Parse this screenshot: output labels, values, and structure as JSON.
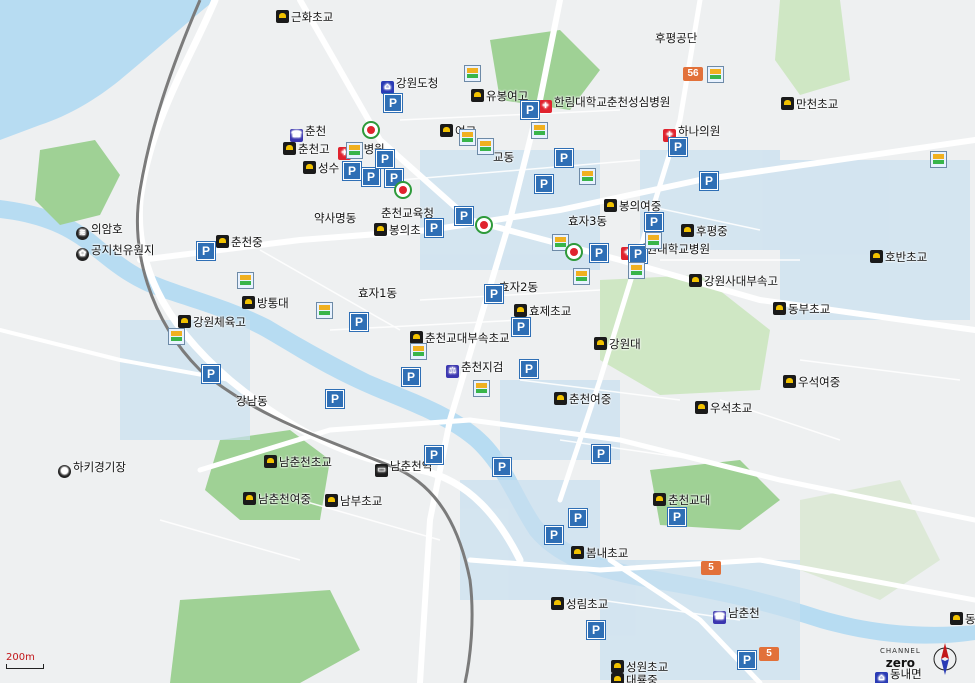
{
  "map": {
    "scale_label": "200m",
    "brand": {
      "line1": "CHANNEL",
      "line2": "zero"
    },
    "compass": {
      "name": "compass-rose",
      "north": "N"
    },
    "colors": {
      "background": "#eef0f1",
      "water": "#b7dcf2",
      "green": "#9fd195",
      "road_major": "#ffffff",
      "road_rail": "#777777",
      "parking": "#2f6fb5",
      "route_shield": "#e2713a"
    },
    "places": [
      {
        "id": "gunhwa-es",
        "label": "근화초교",
        "icon": "school"
      },
      {
        "id": "gangwon-dochung",
        "label": "강원도청",
        "icon": "gov"
      },
      {
        "id": "yubong-high",
        "label": "유봉여고",
        "icon": "school"
      },
      {
        "id": "hallym-hospital",
        "label": "한림대학교춘천성심병원",
        "icon": "hosp"
      },
      {
        "id": "hupyeong-industrial",
        "label": "후평공단",
        "icon": ""
      },
      {
        "id": "manchun-es",
        "label": "만천초교",
        "icon": "school"
      },
      {
        "id": "chuncheon-telecom",
        "label": "춘천",
        "icon": "phone"
      },
      {
        "id": "chuncheon-high",
        "label": "춘천고",
        "icon": "school"
      },
      {
        "id": "seongbyeongwon",
        "label": "성병원",
        "icon": "hosp"
      },
      {
        "id": "seongsu",
        "label": "성수",
        "icon": "school"
      },
      {
        "id": "girls-high",
        "label": "여고",
        "icon": "school"
      },
      {
        "id": "gyo-dong",
        "label": "교동",
        "icon": ""
      },
      {
        "id": "hana-clinic",
        "label": "하나의원",
        "icon": "hosp"
      },
      {
        "id": "uiam-lake",
        "label": "의암호",
        "icon": "lake"
      },
      {
        "id": "gongjicheon",
        "label": "공지천유원지",
        "icon": "park"
      },
      {
        "id": "yaksa-myeong",
        "label": "약사명동",
        "icon": ""
      },
      {
        "id": "chuncheon-edu",
        "label": "춘천교육청",
        "icon": ""
      },
      {
        "id": "bongui-es",
        "label": "봉의초",
        "icon": "school"
      },
      {
        "id": "hyoja3",
        "label": "효자3동",
        "icon": ""
      },
      {
        "id": "bongui-girls",
        "label": "봉의여중",
        "icon": "school"
      },
      {
        "id": "hupyeong-ms",
        "label": "후평중",
        "icon": "school"
      },
      {
        "id": "gangwon-univ-hosp",
        "label": "강원대학교병원",
        "icon": "hosp"
      },
      {
        "id": "chuncheon-ms",
        "label": "춘천중",
        "icon": "school"
      },
      {
        "id": "hoban-es",
        "label": "호반초교",
        "icon": "school"
      },
      {
        "id": "gangwon-sadae",
        "label": "강원사대부속고",
        "icon": "school"
      },
      {
        "id": "bangtong-dae",
        "label": "방통대",
        "icon": "school"
      },
      {
        "id": "hyoja2",
        "label": "효자2동",
        "icon": ""
      },
      {
        "id": "hyoja1",
        "label": "효자1동",
        "icon": ""
      },
      {
        "id": "dongbu-es",
        "label": "동부초교",
        "icon": "school"
      },
      {
        "id": "hyoje-es",
        "label": "효제초교",
        "icon": "school"
      },
      {
        "id": "gangwon-sports",
        "label": "강원체육고",
        "icon": "school"
      },
      {
        "id": "chuncheon-kyodae-es",
        "label": "춘천교대부속초교",
        "icon": "school"
      },
      {
        "id": "gangwon-univ",
        "label": "강원대",
        "icon": "school"
      },
      {
        "id": "chuncheon-court",
        "label": "춘천지검",
        "icon": "court"
      },
      {
        "id": "useok-girls",
        "label": "우석여중",
        "icon": "school"
      },
      {
        "id": "gangnam-dong",
        "label": "강남동",
        "icon": ""
      },
      {
        "id": "chuncheon-girls-ms",
        "label": "춘천여중",
        "icon": "school"
      },
      {
        "id": "useok-es",
        "label": "우석초교",
        "icon": "school"
      },
      {
        "id": "hockey-field",
        "label": "하키경기장",
        "icon": "field"
      },
      {
        "id": "namchuncheon-es",
        "label": "남춘천초교",
        "icon": "school"
      },
      {
        "id": "namchuncheon-station",
        "label": "남춘천역",
        "icon": "station"
      },
      {
        "id": "namchuncheon-girls",
        "label": "남춘천여중",
        "icon": "school"
      },
      {
        "id": "nambu-es",
        "label": "남부초교",
        "icon": "school"
      },
      {
        "id": "chuncheon-kyodae",
        "label": "춘천교대",
        "icon": "school"
      },
      {
        "id": "bomnae-es",
        "label": "봄내초교",
        "icon": "school"
      },
      {
        "id": "seongnim-es",
        "label": "성림초교",
        "icon": "school"
      },
      {
        "id": "namchuncheon-telecom",
        "label": "남춘천",
        "icon": "phone"
      },
      {
        "id": "seongwon-es",
        "label": "성원초교",
        "icon": "school"
      },
      {
        "id": "daeryong-ms",
        "label": "대룡중",
        "icon": "school"
      },
      {
        "id": "dong-cut",
        "label": "동",
        "icon": "school"
      },
      {
        "id": "dongnae-myeon",
        "label": "동내면",
        "icon": "gov"
      }
    ],
    "route_shields": [
      {
        "number": "56"
      },
      {
        "number": "5"
      },
      {
        "number": "5"
      }
    ],
    "parking_count_label": "P"
  }
}
